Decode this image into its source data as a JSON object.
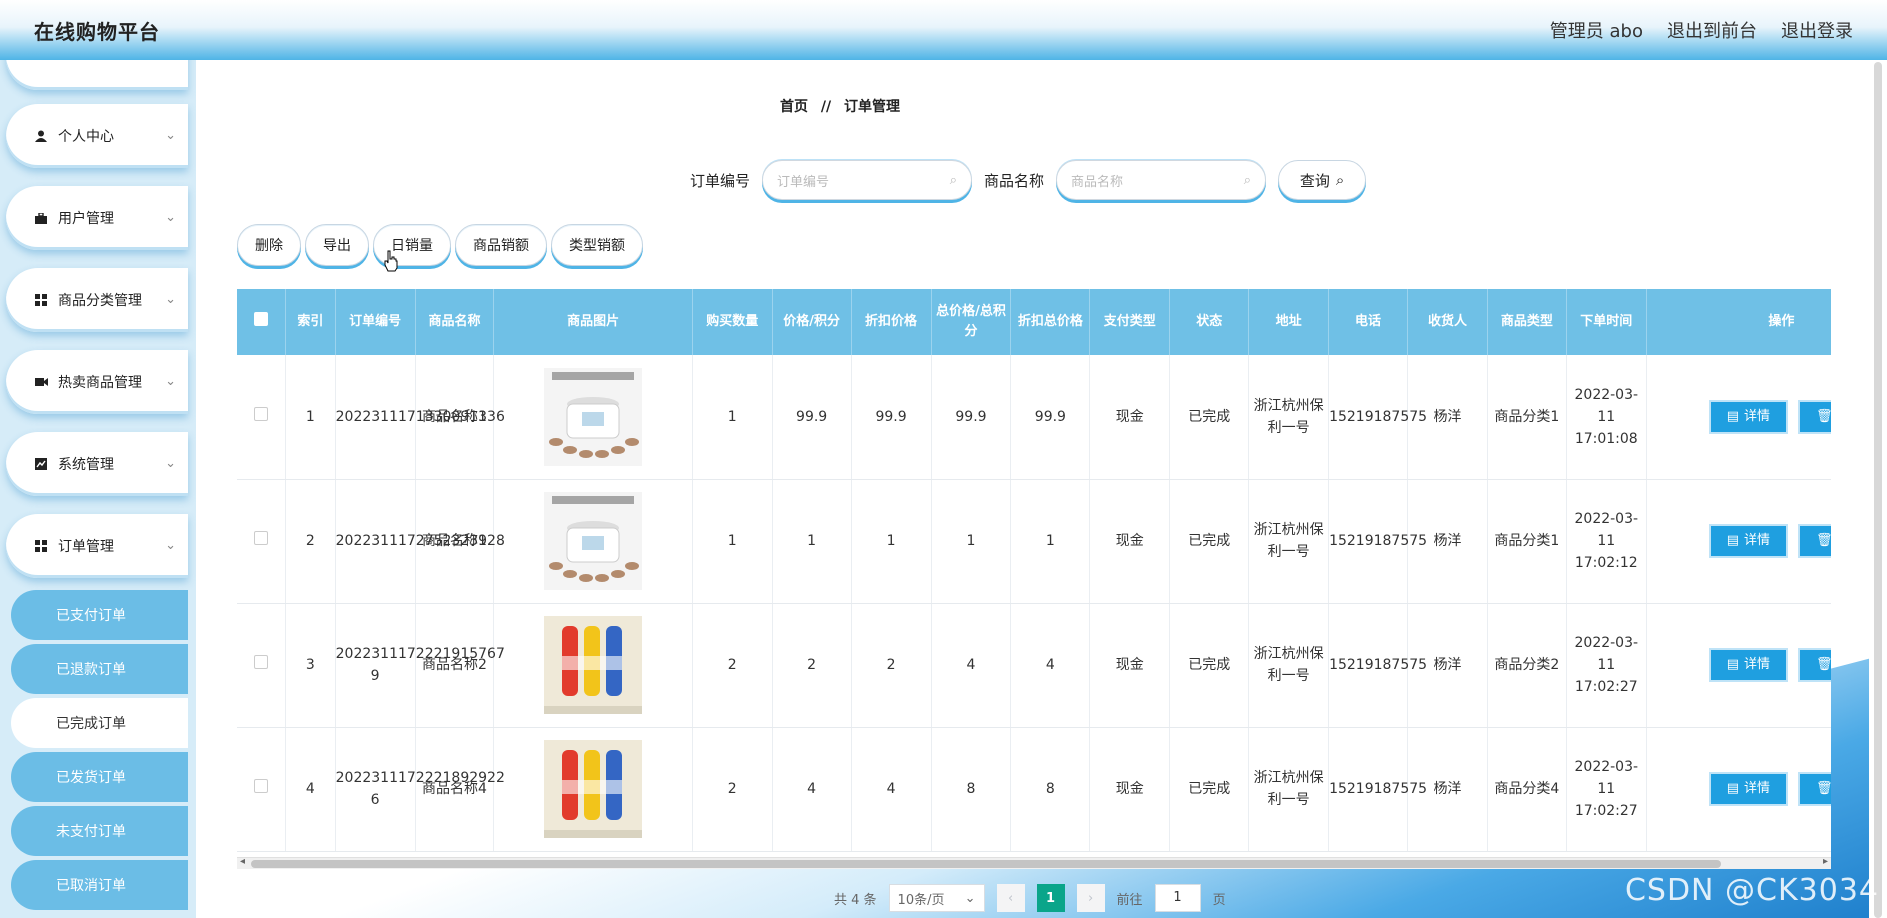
{
  "header": {
    "title": "在线购物平台",
    "user_label": "管理员 abo",
    "to_front_label": "退出到前台",
    "logout_label": "退出登录"
  },
  "sidebar": {
    "menus": [
      {
        "label": "个人中心",
        "icon": "user-icon"
      },
      {
        "label": "用户管理",
        "icon": "briefcase-icon"
      },
      {
        "label": "商品分类管理",
        "icon": "grid-icon"
      },
      {
        "label": "热卖商品管理",
        "icon": "video-icon"
      },
      {
        "label": "系统管理",
        "icon": "chart-icon"
      },
      {
        "label": "订单管理",
        "icon": "grid-icon"
      }
    ],
    "sub_items": [
      "已支付订单",
      "已退款订单",
      "已完成订单",
      "已发货订单",
      "未支付订单",
      "已取消订单"
    ],
    "active_sub": "已完成订单"
  },
  "breadcrumb": {
    "home": "首页",
    "separator": "//",
    "current": "订单管理"
  },
  "search": {
    "order_label": "订单编号",
    "order_placeholder": "订单编号",
    "product_label": "商品名称",
    "product_placeholder": "商品名称",
    "query_label": "查询"
  },
  "actions": [
    "删除",
    "导出",
    "日销量",
    "商品销额",
    "类型销额"
  ],
  "table": {
    "headers": [
      "索引",
      "订单编号",
      "商品名称",
      "商品图片",
      "购买数量",
      "价格/积分",
      "折扣价格",
      "总价格/总积分",
      "折扣总价格",
      "支付类型",
      "状态",
      "地址",
      "电话",
      "收货人",
      "商品类型",
      "下单时间",
      "操作"
    ],
    "detail_label": "详情",
    "delete_label": "删",
    "rows": [
      {
        "index": "1",
        "order_no": "2022311171330091336",
        "product": "商品名称1",
        "image": "rice-cooker",
        "qty": "1",
        "price": "99.9",
        "discount_price": "99.9",
        "total": "99.9",
        "discount_total": "99.9",
        "pay_type": "现金",
        "status": "已完成",
        "address": "浙江杭州保利一号",
        "phone": "15219187575",
        "receiver": "杨洋",
        "category": "商品分类1",
        "time": "2022-03-11 17:01:08"
      },
      {
        "index": "2",
        "order_no": "2022311172752323928",
        "product": "商品名称1",
        "image": "rice-cooker",
        "qty": "1",
        "price": "1",
        "discount_price": "1",
        "total": "1",
        "discount_total": "1",
        "pay_type": "现金",
        "status": "已完成",
        "address": "浙江杭州保利一号",
        "phone": "15219187575",
        "receiver": "杨洋",
        "category": "商品分类1",
        "time": "2022-03-11 17:02:12"
      },
      {
        "index": "3",
        "order_no": "2022311172221915767 9",
        "product": "商品名称2",
        "image": "bottles",
        "qty": "2",
        "price": "2",
        "discount_price": "2",
        "total": "4",
        "discount_total": "4",
        "pay_type": "现金",
        "status": "已完成",
        "address": "浙江杭州保利一号",
        "phone": "15219187575",
        "receiver": "杨洋",
        "category": "商品分类2",
        "time": "2022-03-11 17:02:27"
      },
      {
        "index": "4",
        "order_no": "2022311172221892922 6",
        "product": "商品名称4",
        "image": "bottles",
        "qty": "2",
        "price": "4",
        "discount_price": "4",
        "total": "8",
        "discount_total": "8",
        "pay_type": "现金",
        "status": "已完成",
        "address": "浙江杭州保利一号",
        "phone": "15219187575",
        "receiver": "杨洋",
        "category": "商品分类4",
        "time": "2022-03-11 17:02:27"
      }
    ]
  },
  "pagination": {
    "total_label": "共 4 条",
    "page_size": "10条/页",
    "current_page": "1",
    "goto_label": "前往",
    "goto_value": "1",
    "page_suffix": "页"
  },
  "watermark": "CSDN @CK3034"
}
